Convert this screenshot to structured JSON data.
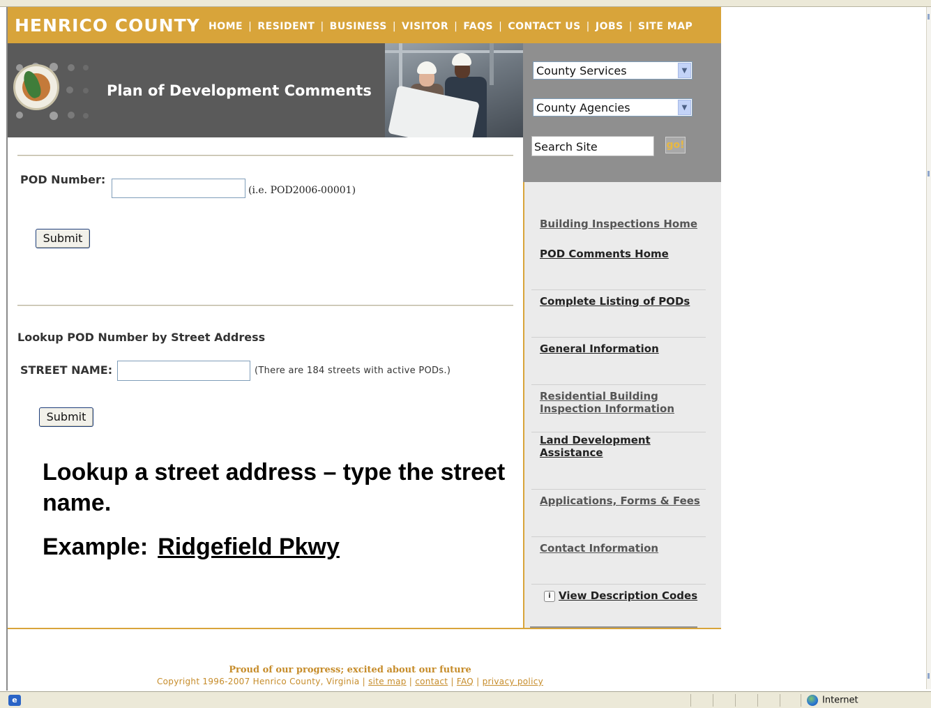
{
  "header": {
    "brand": "HENRICO COUNTY",
    "nav": [
      "HOME",
      "RESIDENT",
      "BUSINESS",
      "VISITOR",
      "FAQS",
      "CONTACT US",
      "JOBS",
      "SITE MAP"
    ],
    "accent_color": "#d8a43a"
  },
  "banner": {
    "title": "Plan of Development Comments"
  },
  "sidebar": {
    "county_services": "County Services",
    "county_agencies": "County Agencies",
    "search_value": "Search Site",
    "go_label": "go!",
    "links": [
      {
        "label": "Building Inspections Home"
      },
      {
        "label": "POD Comments Home"
      },
      {
        "label": "Complete Listing of PODs"
      },
      {
        "label": "General Information"
      },
      {
        "label": "Residential Building Inspection Information"
      },
      {
        "label": "Land Development Assistance"
      },
      {
        "label": "Applications, Forms & Fees"
      },
      {
        "label": "Contact Information"
      },
      {
        "label": "View Description Codes",
        "icon": "info-icon"
      }
    ]
  },
  "pod_form": {
    "label": "POD Number:",
    "value": "",
    "hint": "(i.e. POD2006-00001)",
    "submit_label": "Submit"
  },
  "street_form": {
    "heading": "Lookup POD Number by Street Address",
    "label": "STREET NAME:",
    "value": "",
    "hint": "(There are 184 streets with active PODs.)",
    "submit_label": "Submit"
  },
  "callout": {
    "text": "Lookup a street address – type the street name.",
    "example_label": "Example:",
    "example_value": "Ridgefield Pkwy"
  },
  "footer": {
    "tagline": "Proud of our progress; excited about our future",
    "copyright": "Copyright 1996-2007 Henrico County, Virginia",
    "links": [
      "site map",
      "contact",
      "FAQ",
      "privacy policy"
    ]
  },
  "status_bar": {
    "zone": "Internet"
  }
}
